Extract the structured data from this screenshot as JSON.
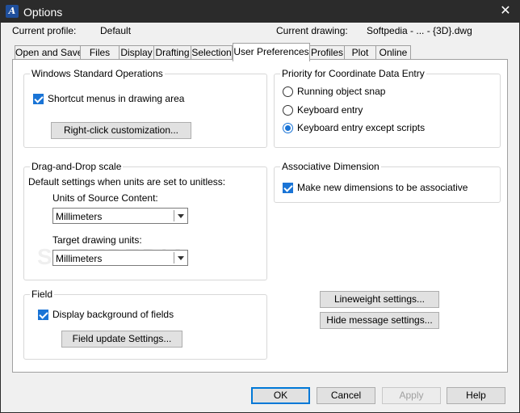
{
  "window": {
    "title": "Options"
  },
  "header": {
    "profile_label": "Current profile:",
    "profile_value": "Default",
    "drawing_label": "Current drawing:",
    "drawing_value": "Softpedia - ... - {3D}.dwg"
  },
  "tabs": [
    {
      "label": "Open and Save"
    },
    {
      "label": "Files"
    },
    {
      "label": "Display"
    },
    {
      "label": "Drafting"
    },
    {
      "label": "Selection"
    },
    {
      "label": "User Preferences"
    },
    {
      "label": "Profiles"
    },
    {
      "label": "Plot"
    },
    {
      "label": "Online"
    }
  ],
  "windows_ops": {
    "title": "Windows Standard Operations",
    "shortcut_menus": "Shortcut menus in drawing area",
    "right_click_button": "Right-click customization..."
  },
  "coord_priority": {
    "title": "Priority for Coordinate Data Entry",
    "options": [
      {
        "label": "Running object snap",
        "selected": false
      },
      {
        "label": "Keyboard entry",
        "selected": false
      },
      {
        "label": "Keyboard entry except scripts",
        "selected": true
      }
    ]
  },
  "drag_drop": {
    "title": "Drag-and-Drop scale",
    "description": "Default settings when units are set to unitless:",
    "source_label": "Units of Source Content:",
    "source_value": "Millimeters",
    "target_label": "Target drawing units:",
    "target_value": "Millimeters"
  },
  "assoc_dim": {
    "title": "Associative Dimension",
    "checkbox": "Make new dimensions to be associative"
  },
  "field": {
    "title": "Field",
    "checkbox": "Display background of fields",
    "button": "Field update Settings..."
  },
  "side_buttons": {
    "lineweight": "Lineweight settings...",
    "hide_message": "Hide message settings..."
  },
  "footer": {
    "ok": "OK",
    "cancel": "Cancel",
    "apply": "Apply",
    "help": "Help"
  },
  "watermark": "SOFTPEDIA"
}
